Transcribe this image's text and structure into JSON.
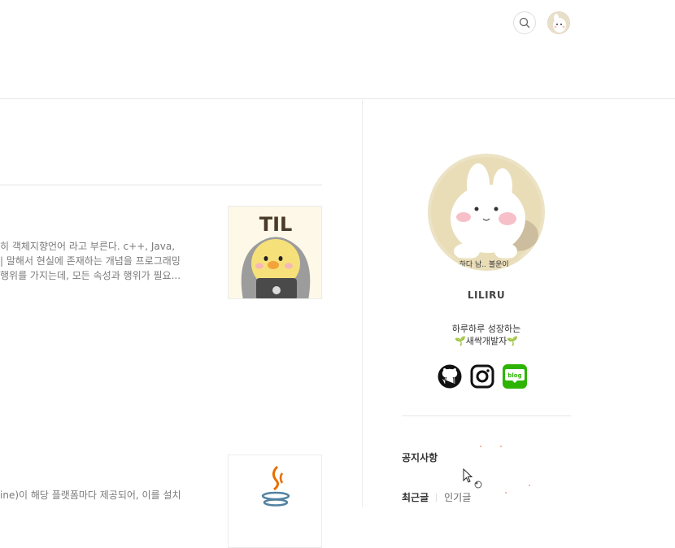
{
  "header": {
    "search_icon": "search-icon",
    "avatar_icon": "profile-avatar-icon"
  },
  "posts": [
    {
      "excerpt_lines": [
        "히 객체지향언어 라고 부른다. c++, Java,",
        "| 말해서 현실에 존재하는 개념을 프로그래밍",
        "행위를 가지는데, 모든 속성과 행위가 필요..."
      ],
      "thumbnail_text": "TIL",
      "thumbnail_icon": "til-character-thumbnail"
    },
    {
      "excerpt_lines": [
        "ine)이 해당 플랫폼마다 제공되어, 이를 설치"
      ],
      "thumbnail_icon": "java-logo-thumbnail"
    }
  ],
  "sidebar": {
    "profile_caption": "하다 남.. 볼운이 .",
    "blog_name": "LILIRU",
    "description_lines": [
      "하루하루 성장하는",
      "🌱새싹개발자🌱"
    ],
    "socials": [
      {
        "name": "github",
        "icon": "github-icon"
      },
      {
        "name": "instagram",
        "icon": "instagram-icon"
      },
      {
        "name": "blog",
        "icon": "naver-blog-icon",
        "label": "blog",
        "color": "#2db400"
      }
    ],
    "notice_heading": "공지사항",
    "tabs": {
      "recent": "최근글",
      "popular": "인기글"
    }
  },
  "colors": {
    "divider": "#e6e6e6",
    "text_muted": "#7a7a7a",
    "blog_green": "#2db400"
  }
}
